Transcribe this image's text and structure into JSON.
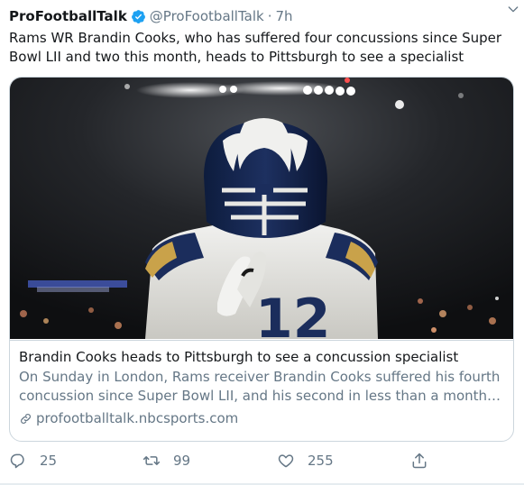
{
  "tweet": {
    "display_name": "ProFootballTalk",
    "handle": "@ProFootballTalk",
    "separator": "·",
    "time": "7h",
    "text": "Rams WR Brandin Cooks, who has suffered four concussions since Super Bowl LII and two this month, heads to Pittsburgh to see a specialist"
  },
  "card": {
    "title": "Brandin Cooks heads to Pittsburgh to see a concussion specialist",
    "description_line1": "On Sunday in London, Rams receiver Brandin Cooks suffered his fourth",
    "description_line2": "concussion since Super Bowl LII, and his second in less than a month. O...",
    "domain": "profootballtalk.nbcsports.com",
    "image_icon": "football-player-photo"
  },
  "actions": {
    "reply_count": "25",
    "retweet_count": "99",
    "like_count": "255"
  },
  "colors": {
    "text": "#14171a",
    "secondary": "#657786",
    "verified": "#1da1f2",
    "border": "#ccd6dd"
  },
  "icons": [
    "verified-badge-icon",
    "chevron-down-icon",
    "link-icon",
    "reply-icon",
    "retweet-icon",
    "like-icon",
    "share-icon"
  ]
}
